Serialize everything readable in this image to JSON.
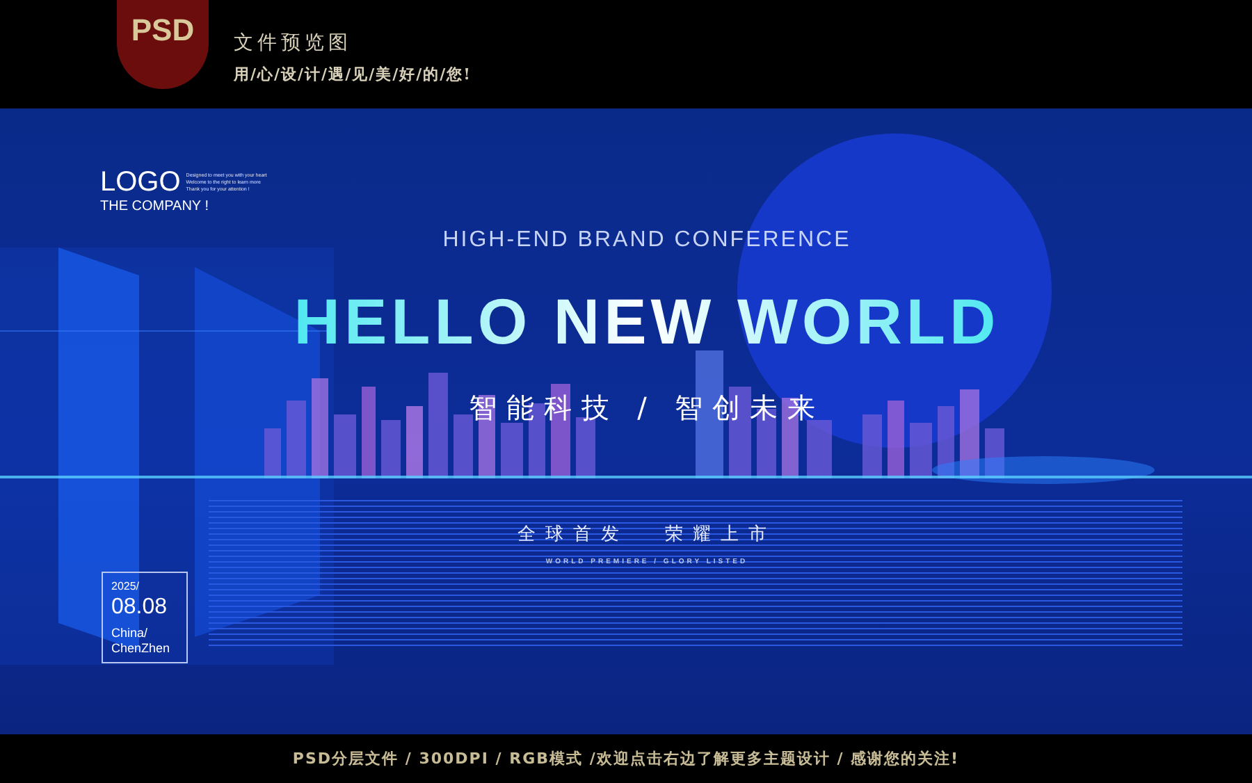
{
  "header": {
    "badge": "PSD",
    "title": "文件预览图",
    "slogan": "用/心/设/计/遇/见/美/好/的/您!"
  },
  "poster": {
    "logo": {
      "mark": "LOGO",
      "company": "THE COMPANY !",
      "blurb": [
        "Designed to meet you with your heart",
        "Welcome to the right to learn more",
        "Thank you for your attention !"
      ]
    },
    "kicker": "HIGH-END BRAND CONFERENCE",
    "title": "HELLO NEW WORLD",
    "subtitle": "智能科技 / 智创未来",
    "tagline": [
      "全球首发",
      "荣耀上市"
    ],
    "tagline_en": "WORLD PREMIERE / GLORY LISTED",
    "date": {
      "year": "2025/",
      "day": "08.08",
      "place": [
        "China/",
        "ChenZhen"
      ]
    }
  },
  "footer": {
    "text": "PSD分层文件 / 300DPI / RGB模式 /欢迎点击右边了解更多主题设计 / 感谢您的关注!"
  }
}
